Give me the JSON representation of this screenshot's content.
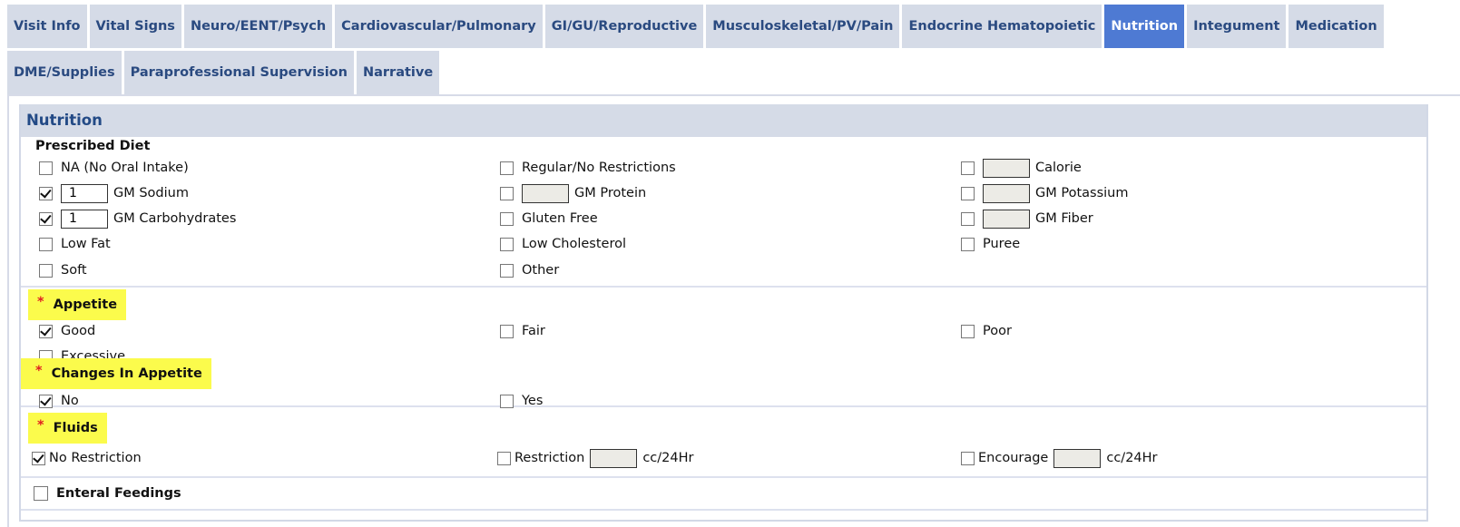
{
  "tabs": {
    "row1": [
      {
        "label": "Visit Info",
        "active": false
      },
      {
        "label": "Vital Signs",
        "active": false
      },
      {
        "label": "Neuro/EENT/Psych",
        "active": false
      },
      {
        "label": "Cardiovascular/Pulmonary",
        "active": false
      },
      {
        "label": "GI/GU/Reproductive",
        "active": false
      },
      {
        "label": "Musculoskeletal/PV/Pain",
        "active": false
      },
      {
        "label": "Endocrine Hematopoietic",
        "active": false
      },
      {
        "label": "Nutrition",
        "active": true
      },
      {
        "label": "Integument",
        "active": false
      },
      {
        "label": "Medication",
        "active": false
      }
    ],
    "row2": [
      {
        "label": "DME/Supplies",
        "active": false
      },
      {
        "label": "Paraprofessional Supervision",
        "active": false
      },
      {
        "label": "Narrative",
        "active": false
      }
    ]
  },
  "panel": {
    "title": "Nutrition",
    "prescribed_diet": {
      "title": "Prescribed Diet",
      "na": {
        "label": "NA (No Oral Intake)",
        "checked": false
      },
      "regular": {
        "label": "Regular/No Restrictions",
        "checked": false
      },
      "calorie": {
        "label": "Calorie",
        "checked": false,
        "value": ""
      },
      "sodium": {
        "label": "GM Sodium",
        "checked": true,
        "value": "1"
      },
      "protein": {
        "label": "GM Protein",
        "checked": false,
        "value": ""
      },
      "potassium": {
        "label": "GM Potassium",
        "checked": false,
        "value": ""
      },
      "carbs": {
        "label": "GM Carbohydrates",
        "checked": true,
        "value": "1"
      },
      "gluten": {
        "label": "Gluten Free",
        "checked": false
      },
      "fiber": {
        "label": "GM Fiber",
        "checked": false,
        "value": ""
      },
      "low_fat": {
        "label": "Low Fat",
        "checked": false
      },
      "low_chol": {
        "label": "Low Cholesterol",
        "checked": false
      },
      "puree": {
        "label": "Puree",
        "checked": false
      },
      "soft": {
        "label": "Soft",
        "checked": false
      },
      "other": {
        "label": "Other",
        "checked": false
      }
    },
    "appetite": {
      "required_marker": "*",
      "title": "Appetite",
      "good": {
        "label": "Good",
        "checked": true
      },
      "fair": {
        "label": "Fair",
        "checked": false
      },
      "poor": {
        "label": "Poor",
        "checked": false
      },
      "excessive": {
        "label": "Excessive",
        "checked": false
      }
    },
    "changes": {
      "required_marker": "*",
      "title": "Changes In Appetite",
      "no": {
        "label": "No",
        "checked": true
      },
      "yes": {
        "label": "Yes",
        "checked": false
      }
    },
    "fluids": {
      "required_marker": "*",
      "title": "Fluids",
      "no_restriction": {
        "label": "No Restriction",
        "checked": true
      },
      "restriction": {
        "label": "Restriction",
        "checked": false,
        "value": "",
        "unit": "cc/24Hr"
      },
      "encourage": {
        "label": "Encourage",
        "checked": false,
        "value": "",
        "unit": "cc/24Hr"
      }
    },
    "enteral": {
      "label": "Enteral Feedings",
      "checked": false
    }
  },
  "colors": {
    "tab_bg": "#d5dbe7",
    "tab_text": "#2a4a80",
    "tab_active_bg": "#4e7ad3",
    "required_highlight": "#fbfb4c",
    "required_star": "#e02020"
  }
}
